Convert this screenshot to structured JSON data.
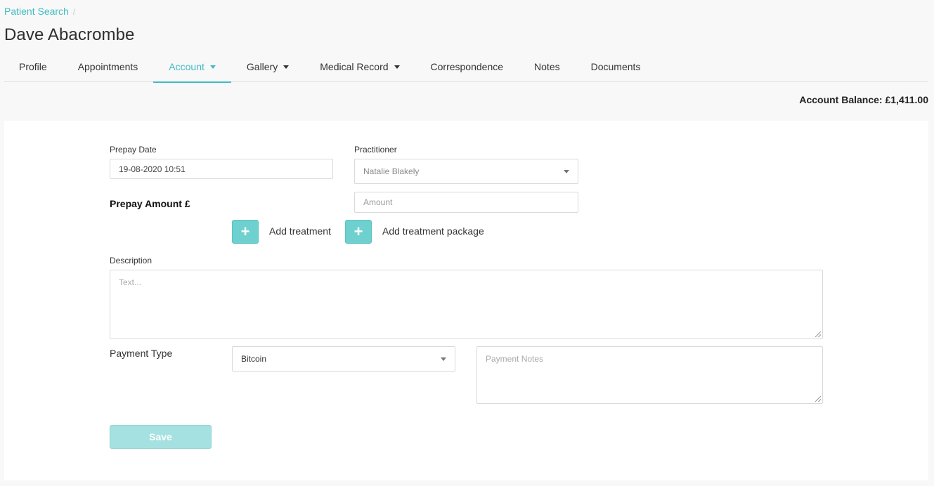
{
  "breadcrumb": {
    "link": "Patient Search",
    "separator": "/"
  },
  "page_title": "Dave Abacrombe",
  "tabs": [
    {
      "label": "Profile",
      "dropdown": false,
      "active": false
    },
    {
      "label": "Appointments",
      "dropdown": false,
      "active": false
    },
    {
      "label": "Account",
      "dropdown": true,
      "active": true
    },
    {
      "label": "Gallery",
      "dropdown": true,
      "active": false
    },
    {
      "label": "Medical Record",
      "dropdown": true,
      "active": false
    },
    {
      "label": "Correspondence",
      "dropdown": false,
      "active": false
    },
    {
      "label": "Notes",
      "dropdown": false,
      "active": false
    },
    {
      "label": "Documents",
      "dropdown": false,
      "active": false
    }
  ],
  "account_balance": "Account Balance: £1,411.00",
  "form": {
    "prepay_date_label": "Prepay Date",
    "prepay_date_value": "19-08-2020 10:51",
    "practitioner_label": "Practitioner",
    "practitioner_value": "Natalie Blakely",
    "prepay_amount_label": "Prepay Amount £",
    "amount_placeholder": "Amount",
    "add_treatment_label": "Add treatment",
    "add_package_label": "Add treatment package",
    "plus_symbol": "+",
    "description_label": "Description",
    "description_placeholder": "Text...",
    "payment_type_label": "Payment Type",
    "payment_type_value": "Bitcoin",
    "payment_notes_placeholder": "Payment Notes",
    "save_label": "Save"
  },
  "colors": {
    "accent": "#3fbcc1",
    "plus_button": "#6ed1d0",
    "save_button_disabled": "#a5e1e0"
  }
}
